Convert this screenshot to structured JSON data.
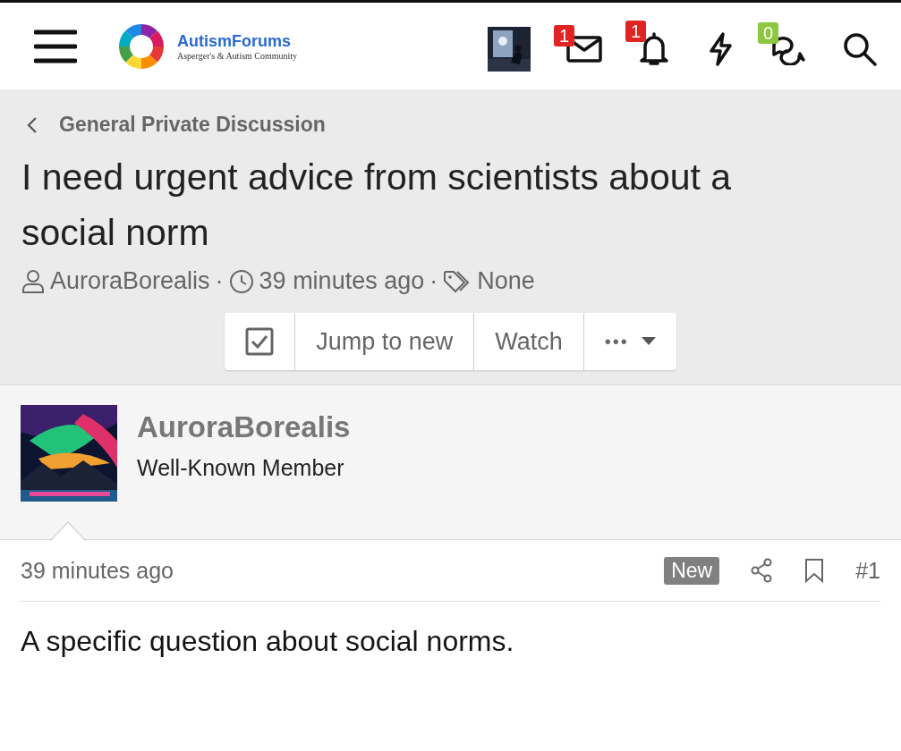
{
  "header": {
    "logo": {
      "name": "AutismForums",
      "tagline": "Asperger's & Autism Community"
    },
    "icons": [
      {
        "kind": "avatar"
      },
      {
        "kind": "inbox",
        "badge": "1",
        "color": "#e02424"
      },
      {
        "kind": "alerts",
        "badge": "1",
        "color": "#e02424"
      },
      {
        "kind": "whats-new"
      },
      {
        "kind": "conversations",
        "badge": "0",
        "color": "#8dc63f"
      },
      {
        "kind": "search"
      }
    ]
  },
  "breadcrumb": "General Private Discussion",
  "thread": {
    "title": "I need urgent advice from scientists about a social norm",
    "author": "AuroraBorealis",
    "time": "39 minutes ago",
    "tags": "None",
    "separators": [
      "·",
      "·"
    ],
    "buttons": [
      {
        "kind": "check"
      },
      {
        "kind": "text",
        "label": "Jump to new"
      },
      {
        "kind": "text",
        "label": "Watch"
      },
      {
        "kind": "more",
        "label": "•••"
      }
    ]
  },
  "post": {
    "user": {
      "name": "AuroraBorealis",
      "role": "Well-Known Member"
    },
    "time": "39 minutes ago",
    "badge": "New",
    "number": "#1",
    "body": "A specific question about social norms."
  }
}
